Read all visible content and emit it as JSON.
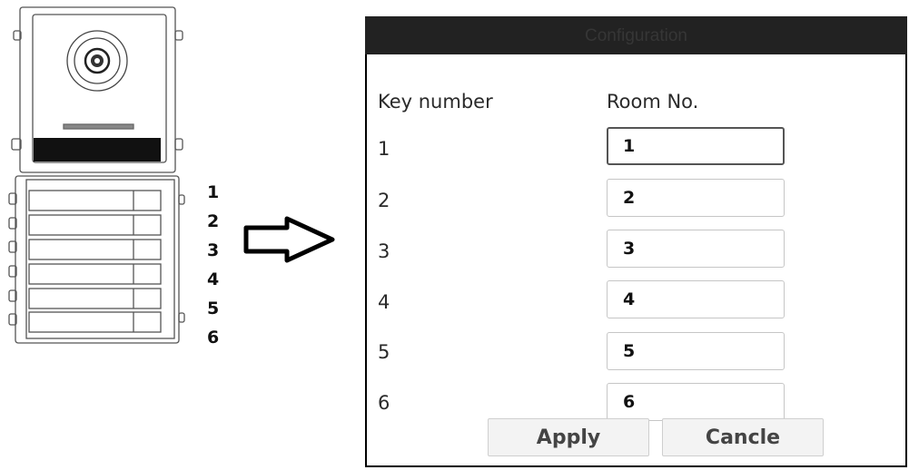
{
  "device": {
    "key_labels": [
      "1",
      "2",
      "3",
      "4",
      "5",
      "6"
    ]
  },
  "dialog": {
    "title": "Configuration",
    "headers": {
      "key_number": "Key number",
      "room_no": "Room No."
    },
    "rows": [
      {
        "key": "1",
        "room": "1"
      },
      {
        "key": "2",
        "room": "2"
      },
      {
        "key": "3",
        "room": "3"
      },
      {
        "key": "4",
        "room": "4"
      },
      {
        "key": "5",
        "room": "5"
      },
      {
        "key": "6",
        "room": "6"
      }
    ],
    "buttons": {
      "apply": "Apply",
      "cancel": "Cancle"
    }
  },
  "colors": {
    "titlebar": "#222222",
    "border": "#000000",
    "button_bg": "#f3f3f3"
  },
  "icons": [
    "camera-lens-icon",
    "right-arrow-icon"
  ]
}
